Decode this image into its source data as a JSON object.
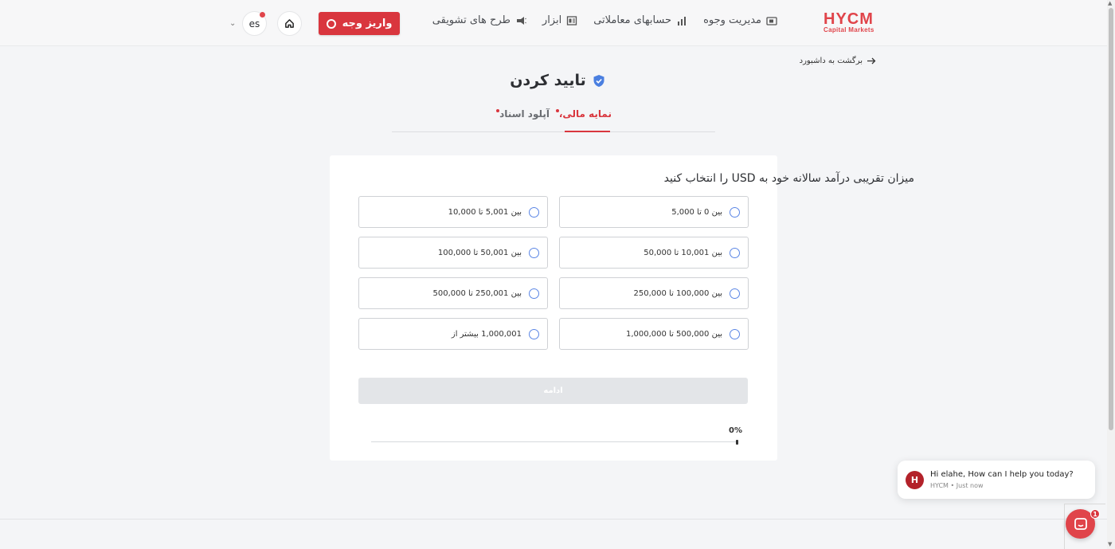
{
  "header": {
    "logo_main": "HYCM",
    "logo_sub": "Capital Markets",
    "nav": [
      {
        "label": "مدیریت وجوه",
        "icon": "wallet-icon"
      },
      {
        "label": "حسابهای معاملاتی",
        "icon": "chart-icon"
      },
      {
        "label": "ابزار",
        "icon": "tools-icon"
      },
      {
        "label": "طرح های تشویقی",
        "icon": "megaphone-icon"
      }
    ],
    "deposit_label": "واریز وجه",
    "lang": "es"
  },
  "back_link": "برگشت به داشبورد",
  "page_title": "تایید کردن",
  "tabs": [
    {
      "label": "نمایه مالی،",
      "active": true
    },
    {
      "label": "آپلود اسناد",
      "active": false
    }
  ],
  "question": "میزان تقریبی درآمد سالانه خود به USD را انتخاب کنید",
  "options": [
    "بین 0 تا 5,000",
    "بین 5,001 تا 10,000",
    "بین 10,001 تا 50,000",
    "بین 50,001 تا 100,000",
    "بین 100,000 تا 250,000",
    "بین 250,001 تا 500,000",
    "بین 500,000 تا 1,000,000",
    "1,000,001 بیشتر از"
  ],
  "continue_label": "ادامه",
  "progress": {
    "percent_text": "0%",
    "value": 0
  },
  "chat": {
    "avatar": "H",
    "message": "Hi elahe, How can I help you today?",
    "meta": "HYCM • Just now",
    "badge": "1"
  },
  "colors": {
    "accent": "#d9363e",
    "radio": "#5b86e5",
    "brand": "#e0444a"
  }
}
